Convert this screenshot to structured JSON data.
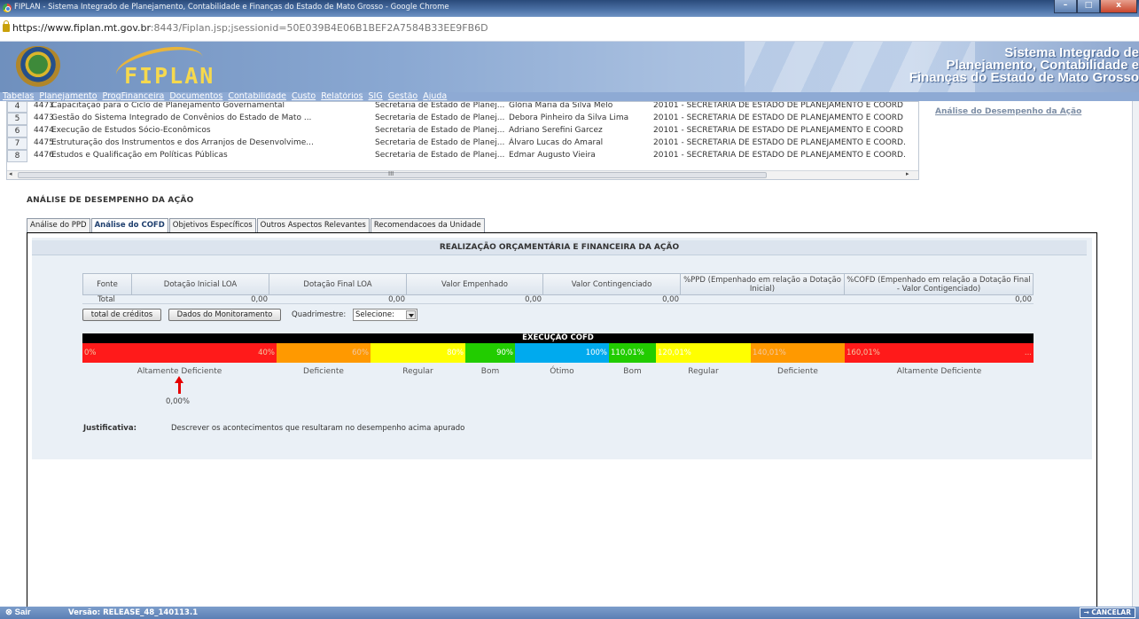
{
  "window": {
    "title": "FIPLAN - Sistema Integrado de Planejamento, Contabilidade e Finanças do Estado de Mato Grosso - Google Chrome"
  },
  "address": {
    "host": "https://www.fiplan.mt.gov.br",
    "rest": ":8443/Fiplan.jsp;jsessionid=50E039B4E06B1BEF2A7584B33EE9FB6D"
  },
  "header": {
    "logo_text": "FIPLAN",
    "system_title_line1": "Sistema Integrado de",
    "system_title_line2": "Planejamento, Contabilidade e",
    "system_title_line3": "Finanças do Estado de Mato Grosso"
  },
  "menu": [
    "Tabelas",
    "Planejamento",
    "ProgFinanceira",
    "Documentos",
    "Contabilidade",
    "Custo",
    "Relatórios",
    "SIG",
    "Gestão",
    "Ajuda"
  ],
  "grid_rows": [
    {
      "n": "4",
      "code": "4471",
      "name": "Capacitação para o Ciclo de Planejamento Governamental",
      "org": "Secretaria de Estado de Planej...",
      "resp": "Glória Maria da Silva Melo",
      "unit": "20101 - SECRETARIA DE ESTADO DE PLANEJAMENTO E COORD"
    },
    {
      "n": "5",
      "code": "4473",
      "name": "Gestão do Sistema Integrado de Convênios do Estado de Mato ...",
      "org": "Secretaria de Estado de Planej...",
      "resp": "Debora Pinheiro da Silva Lima",
      "unit": "20101 - SECRETARIA DE ESTADO DE PLANEJAMENTO E COORD"
    },
    {
      "n": "6",
      "code": "4474",
      "name": "Execução de Estudos Sócio-Econômicos",
      "org": "Secretaria de Estado de Planej...",
      "resp": "Adriano Serefini Garcez",
      "unit": "20101 - SECRETARIA DE ESTADO DE PLANEJAMENTO E COORD"
    },
    {
      "n": "7",
      "code": "4475",
      "name": "Estruturação dos Instrumentos e dos Arranjos de Desenvolvime...",
      "org": "Secretaria de Estado de Planej...",
      "resp": "Álvaro Lucas do Amaral",
      "unit": "20101 - SECRETARIA DE ESTADO DE PLANEJAMENTO E COORD."
    },
    {
      "n": "8",
      "code": "4476",
      "name": "Estudos e Qualificação em Políticas Públicas",
      "org": "Secretaria de Estado de Planej...",
      "resp": "Edmar Augusto Vieira",
      "unit": "20101 - SECRETARIA DE ESTADO DE PLANEJAMENTO E COORD."
    }
  ],
  "grid_scroll": {
    "left": "◂",
    "mid": "III",
    "right": "▸"
  },
  "side_link": "Análise do Desempenho da Ação",
  "section_title": "ANÁLISE DE DESEMPENHO DA AÇÃO",
  "tabs": [
    "Análise do PPD",
    "Análise do COFD",
    "Objetivos Específicos",
    "Outros Aspectos Relevantes",
    "Recomendacoes da Unidade"
  ],
  "realizacao_title": "REALIZAÇÃO ORÇAMENTÁRIA E FINANCEIRA DA AÇÃO",
  "budget": {
    "headers": [
      "Fonte",
      "Dotação Inicial LOA",
      "Dotação Final LOA",
      "Valor Empenhado",
      "Valor Contingenciado",
      "%PPD (Empenhado em relação a Dotação Inicial)",
      "%COFD (Empenhado em relação a Dotação Final - Valor Contigenciado)"
    ],
    "total_row": [
      "Total",
      "0,00",
      "0,00",
      "0,00",
      "0,00",
      "",
      "0,00"
    ]
  },
  "buttons": {
    "total_creditos": "total de créditos",
    "dados_monitoramento": "Dados do Monitoramento"
  },
  "quadrimestre": {
    "label": "Quadrimestre:",
    "value": "Selecione:"
  },
  "execucao": {
    "title": "EXECUÇÃO COFD",
    "segments": [
      {
        "l": "0%",
        "r": "40%",
        "color": "#ff1a1a"
      },
      {
        "l": "",
        "r": "60%",
        "color": "#ff9900"
      },
      {
        "l": "",
        "r": "80%",
        "color": "#ffff00"
      },
      {
        "l": "",
        "r": "90%",
        "color": "#22cc00"
      },
      {
        "l": "",
        "r": "100%",
        "color": "#00aaee"
      },
      {
        "l": "110,01%",
        "r": "",
        "color": "#22cc00"
      },
      {
        "l": "120,01%",
        "r": "",
        "color": "#ffff00"
      },
      {
        "l": "140,01%",
        "r": "",
        "color": "#ff9900"
      },
      {
        "l": "160,01%",
        "r": "...",
        "color": "#ff1a1a"
      }
    ],
    "labels": [
      "Altamente Deficiente",
      "Deficiente",
      "Regular",
      "Bom",
      "Ótimo",
      "Bom",
      "Regular",
      "Deficiente",
      "Altamente Deficiente"
    ],
    "current_value": "0,00%"
  },
  "justificativa": {
    "label": "Justificativa:",
    "text": "Descrever os acontecimentos que resultaram no desempenho acima apurado"
  },
  "statusbar": {
    "sair": "Sair",
    "versao": "Versão: RELEASE_48_140113.1",
    "cancelar": "→ CANCELAR"
  }
}
